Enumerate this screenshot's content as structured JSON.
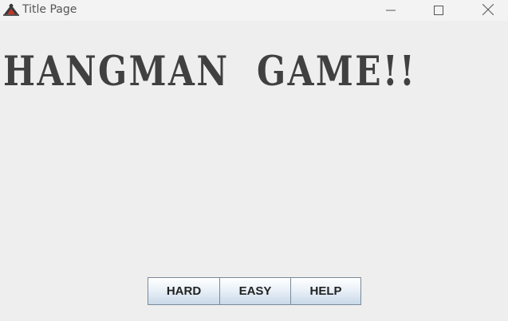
{
  "window": {
    "title": "Title Page",
    "controls": {
      "minimize_icon": "minimize-icon",
      "maximize_icon": "maximize-icon",
      "close_icon": "close-icon"
    }
  },
  "main": {
    "headline": "HANGMAN  GAME!!"
  },
  "buttons": {
    "hard": "HARD",
    "easy": "EASY",
    "help": "HELP"
  },
  "colors": {
    "background": "#eeeeee",
    "headline": "#404040",
    "button_border": "#7a8a99"
  }
}
